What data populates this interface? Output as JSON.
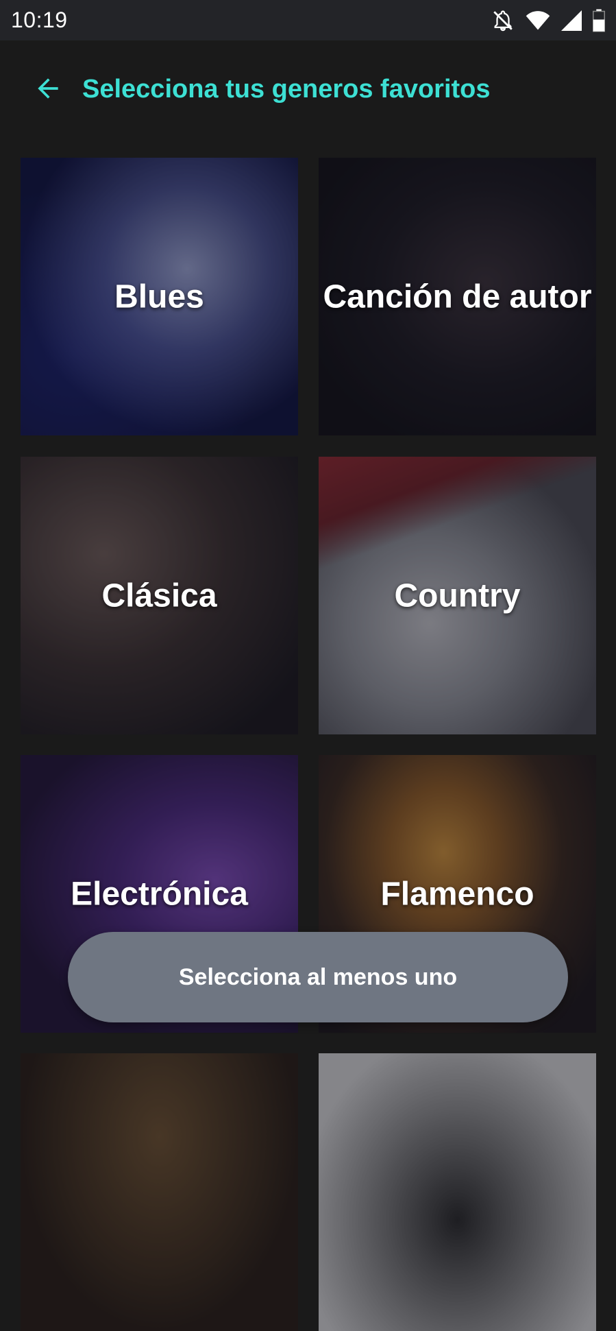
{
  "status_bar": {
    "time": "10:19",
    "icons": [
      "notifications-off-icon",
      "wifi-icon",
      "signal-icon",
      "battery-icon"
    ]
  },
  "header": {
    "back_icon": "arrow-left-icon",
    "title": "Selecciona tus generos favoritos",
    "accent_color": "#3de0d4"
  },
  "genres": [
    {
      "label": "Blues"
    },
    {
      "label": "Canción de autor"
    },
    {
      "label": "Clásica"
    },
    {
      "label": "Country"
    },
    {
      "label": "Electrónica"
    },
    {
      "label": "Flamenco"
    },
    {
      "label": ""
    },
    {
      "label": ""
    }
  ],
  "snackbar": {
    "message": "Selecciona al menos uno"
  }
}
